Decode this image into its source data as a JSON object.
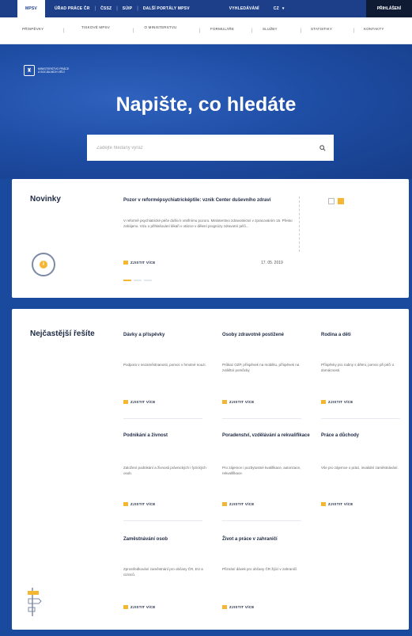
{
  "topbar": {
    "items": [
      "MPSV",
      "ÚŘAD PRÁCE ČR",
      "ČSSZ",
      "SÚIP",
      "DALŠÍ PORTÁLY MPSV",
      "VYHLEDÁVÁNÍ",
      "CZ"
    ],
    "login": "PŘIHLÁŠENÍ"
  },
  "nav": {
    "items": [
      "PŘÍSPĚVKY",
      "TISKOVÉ MPSV",
      "O MINISTERSTVU",
      "FORMULÁŘE",
      "SLUŽBY",
      "STATISTIKY",
      "KONTAKTY"
    ]
  },
  "hero": {
    "logo_line1": "MINISTERSTVO PRÁCE",
    "logo_line2": "A SOCIÁLNÍCH VĚCÍ",
    "title": "Napište, co hledáte",
    "search_placeholder": "Zadejte hledaný výraz"
  },
  "news": {
    "section_title": "Novinky",
    "article_title": "Pozor v reformépsychiatricképtile: vznik Center duševního zdraví",
    "article_body": "V reformě psychiatrické péče došlo k vnitřnímu pozoru. Ministerstvo zdravotnictví v zpracováním 15. Přesto zahájeno. Vizu o přihlašování lékaři v otázce v dělení prognózy zdravotní péči...",
    "more_label": "ZJISTIT VÍCE",
    "date": "17. 05. 2019"
  },
  "faq": {
    "section_title": "Nejčastější řešíte",
    "more_label": "ZJISTIT VÍCE",
    "items": [
      {
        "title": "Dávky a příspěvky",
        "desc": "Podpora v nezaměstnanosti, pomoc v hmotné nouzi."
      },
      {
        "title": "Osoby zdravotně postižené",
        "desc": "Průkaz OZP, příspěvek na mobilitu, příspěvek na zvláštní pomůcky."
      },
      {
        "title": "Rodina a děti",
        "desc": "Příspěvky pro rodiny s dětmi, pomoc při péči o domácnosti."
      },
      {
        "title": "Podnikání a živnost",
        "desc": "Založení podnikání a živnosti právnických i fyzických osob."
      },
      {
        "title": "Poradenství, vzdělávání a rekvalifikace",
        "desc": "Pro zájemce i pozbytostné kvalifikace, autorizace, rekvalifikace."
      },
      {
        "title": "Práce a důchody",
        "desc": "Vše pro zájemce o práci, invalidní zaměstnávání."
      },
      {
        "title": "Zaměstnávání osob",
        "desc": "Zprostředkování zaměstnání pro občany ČR, EU a cizinců."
      },
      {
        "title": "Život a práce v zahraničí",
        "desc": "Přiznání dávek pro občany ČR žijící v zahraničí."
      }
    ]
  },
  "colors": {
    "primary": "#1d3f8a",
    "accent": "#f5b731",
    "text": "#1e2a44"
  }
}
